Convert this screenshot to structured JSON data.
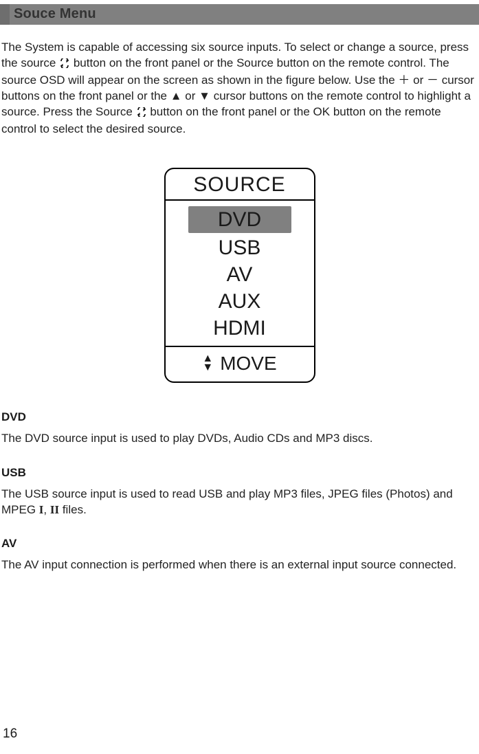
{
  "header": {
    "title": "Souce Menu"
  },
  "intro": {
    "part1": "The System is capable of accessing six source inputs.  To select or change a source, press the source ",
    "part2": " button on the front panel or the Source button on the remote control. The source OSD will appear on the screen as shown in the figure below.  Use the  ",
    "plus": "＋",
    "mid1": " or ",
    "minus": "－",
    "part3": "    cursor buttons on the front panel or the ",
    "up": "▲",
    "mid2": " or ",
    "down": "▼",
    "part4": " cursor buttons on the remote control to highlight a source.  Press the Source  ",
    "part5": " button on the front panel or the OK button on the remote control to select the desired source."
  },
  "osd": {
    "title": "SOURCE",
    "items": [
      {
        "label": "DVD",
        "selected": true
      },
      {
        "label": "USB",
        "selected": false
      },
      {
        "label": "AV",
        "selected": false
      },
      {
        "label": "AUX",
        "selected": false
      },
      {
        "label": "HDMI",
        "selected": false
      }
    ],
    "footer": {
      "up": "▲",
      "down": "▼",
      "move": "MOVE"
    }
  },
  "sections": {
    "dvd": {
      "heading": "DVD",
      "body": "The DVD source input is used to play DVDs, Audio CDs and MP3 discs."
    },
    "usb": {
      "heading": "USB",
      "body_a": "The USB source input is used to read USB and play MP3 files, JPEG files (Photos) and MPEG ",
      "roman1": "I",
      "comma": ", ",
      "roman2": "II",
      "body_b": " files."
    },
    "av": {
      "heading": "AV",
      "body": " The AV input connection is performed when there is an external input source connected."
    }
  },
  "page_number": "16"
}
